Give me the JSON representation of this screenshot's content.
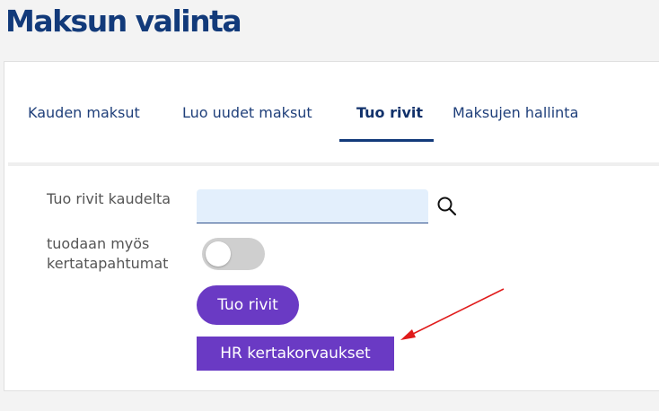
{
  "page": {
    "title": "Maksun valinta"
  },
  "tabs": [
    {
      "label": "Kauden maksut",
      "active": false
    },
    {
      "label": "Luo uudet maksut",
      "active": false
    },
    {
      "label": "Tuo rivit",
      "active": true
    },
    {
      "label": "Maksujen hallinta",
      "active": false
    }
  ],
  "form": {
    "period_label": "Tuo rivit kaudelta",
    "period_value": "",
    "include_label_line1": "tuodaan myös",
    "include_label_line2": "kertatapahtumat",
    "include_enabled": false,
    "search_icon": "search-icon"
  },
  "actions": {
    "import_rows": "Tuo rivit",
    "hr_single": "HR kertakorvaukset"
  },
  "colors": {
    "title": "#123a7a",
    "accent_purple": "#6a3ac4",
    "input_bg": "#e3effc",
    "annotation_arrow": "#e01b1b"
  }
}
